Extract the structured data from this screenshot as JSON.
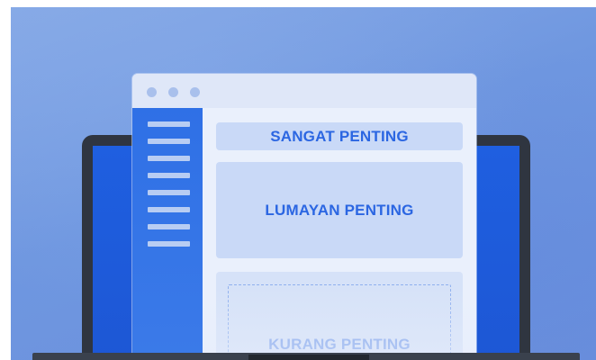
{
  "illustration": {
    "subject": "laptop-with-browser-window",
    "colors": {
      "background": "#7a9fe3",
      "laptop_frame": "#2f3540",
      "laptop_screen": "#1f5fe0",
      "browser_bg": "#e6edfb",
      "sidebar": "#2f70e6",
      "card": "#c9d9f7",
      "card_text": "#2b66e2"
    }
  },
  "browser": {
    "window_dots": [
      "dot",
      "dot",
      "dot"
    ],
    "sidebar_menu_lines": 8
  },
  "cards": {
    "top_label": "SANGAT PENTING",
    "middle_label": "LUMAYAN PENTING",
    "bottom_label": "KURANG PENTING"
  }
}
